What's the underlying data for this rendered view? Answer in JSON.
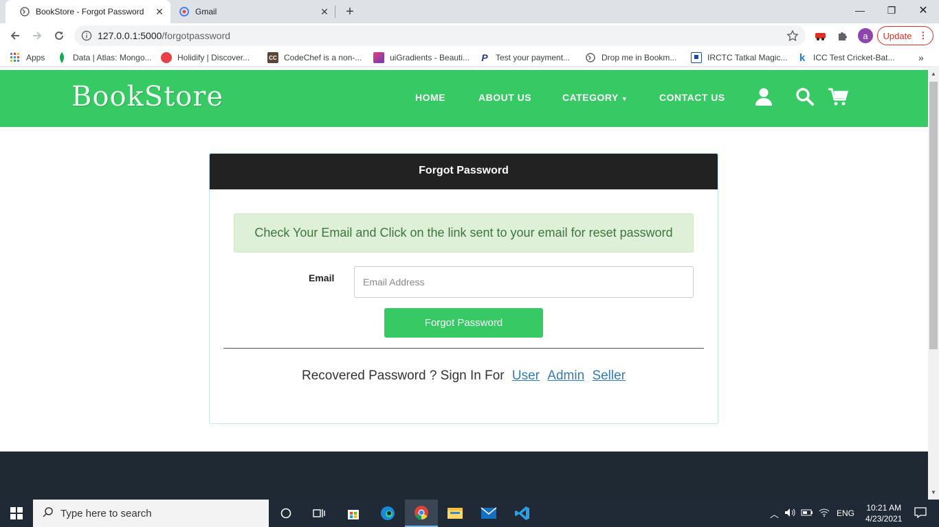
{
  "browser": {
    "tabs": [
      {
        "title": "BookStore - Forgot Password",
        "active": true,
        "icon": "globe-icon"
      },
      {
        "title": "Gmail",
        "active": false,
        "icon": "gmail-icon"
      }
    ],
    "new_tab": "+",
    "url_host": "127.0.0.1:5000",
    "url_path": "/forgotpassword",
    "profile_initial": "a",
    "update_label": "Update"
  },
  "bookmarks": [
    {
      "label": "Apps",
      "icon": "apps-grid-icon",
      "color": "#4285f4"
    },
    {
      "label": "Data | Atlas: Mongo...",
      "icon": "mongodb-leaf-icon",
      "color": "#13aa52"
    },
    {
      "label": "Holidify | Discover...",
      "icon": "holidify-icon",
      "color": "#e8404a"
    },
    {
      "label": "CodeChef is a non-...",
      "icon": "codechef-icon",
      "color": "#5b4638"
    },
    {
      "label": "uiGradients - Beauti...",
      "icon": "uigradients-icon",
      "color": "#9b3fb5"
    },
    {
      "label": "Test your payment...",
      "icon": "paypal-icon",
      "color": "#253b80"
    },
    {
      "label": "Drop me in Bookm...",
      "icon": "globe-icon",
      "color": "#5f6368"
    },
    {
      "label": "IRCTC Tatkal Magic...",
      "icon": "irctc-icon",
      "color": "#1a4c9c"
    },
    {
      "label": "ICC Test Cricket-Bat...",
      "icon": "k-icon",
      "color": "#1a7fd4"
    }
  ],
  "site": {
    "logo": "BookStore",
    "nav": [
      "HOME",
      "ABOUT US",
      "CATEGORY",
      "CONTACT US"
    ],
    "brand_color": "#36c964"
  },
  "card": {
    "title": "Forgot Password",
    "alert": "Check Your Email and Click on the link sent to your email for reset password",
    "email_label": "Email",
    "email_placeholder": "Email Address",
    "submit_label": "Forgot Password",
    "recover_text": "Recovered Password ? Sign In For",
    "links": [
      "User",
      "Admin",
      "Seller"
    ]
  },
  "taskbar": {
    "search_placeholder": "Type here to search",
    "language": "ENG",
    "time": "10:21 AM",
    "date": "4/23/2021"
  }
}
